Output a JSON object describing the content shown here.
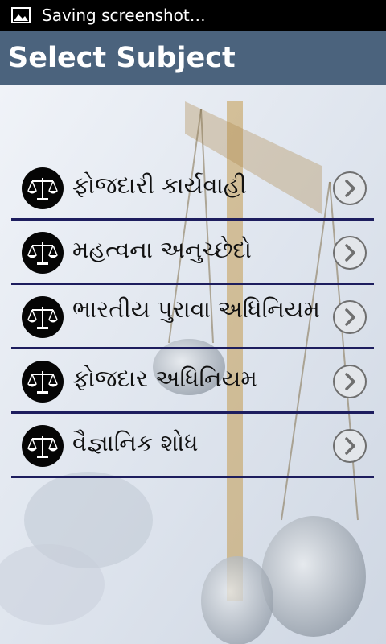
{
  "status_bar": {
    "text": "Saving screenshot…",
    "icon": "image-icon"
  },
  "app_bar": {
    "title": "Select Subject"
  },
  "subjects": [
    {
      "label": "ફોજદારી કાર્યવાહી"
    },
    {
      "label": "મહત્વના અનુચ્છેદો"
    },
    {
      "label": "ભારતીય પુરાવા અધિનિયમ"
    },
    {
      "label": "ફોજદાર અધિનિયમ"
    },
    {
      "label": "વૈજ્ઞાનિક શોધ"
    }
  ],
  "icons": {
    "item": "scales-of-justice-icon",
    "action": "chevron-right-icon"
  },
  "colors": {
    "app_bar": "#4b637d",
    "status_bar": "#000000",
    "divider": "#1d1d5e"
  }
}
